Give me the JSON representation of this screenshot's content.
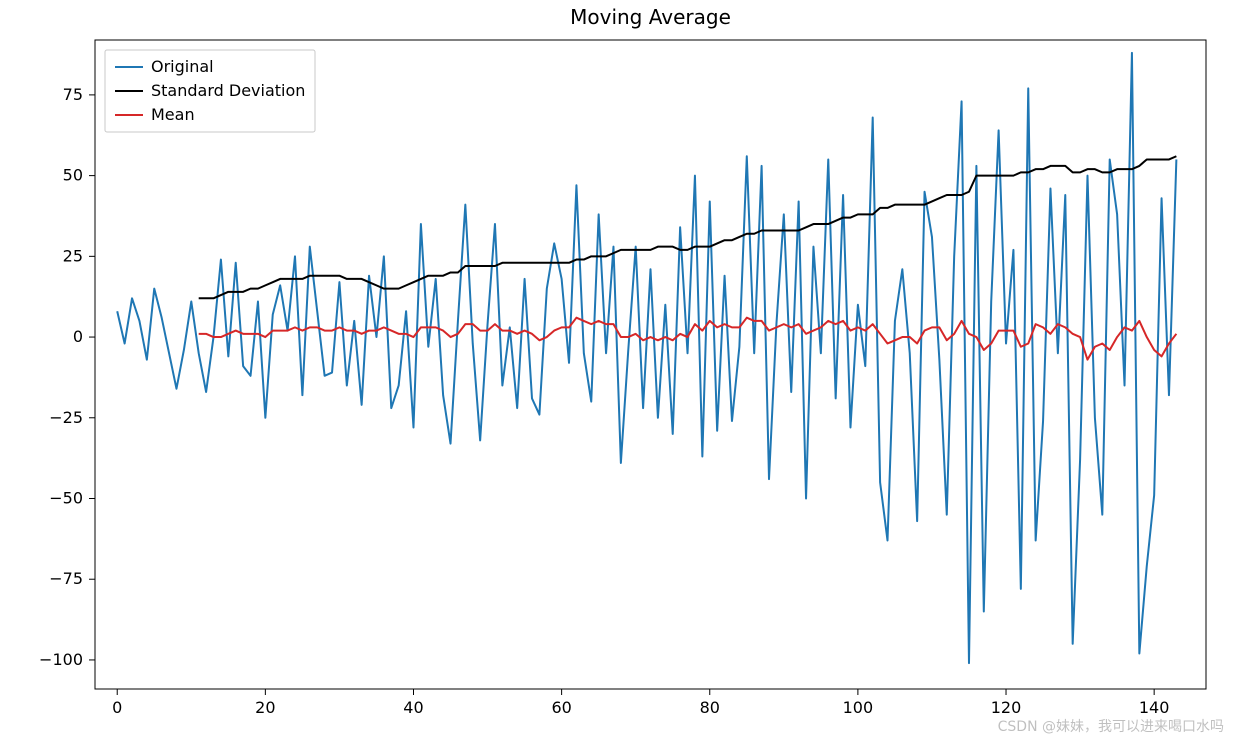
{
  "chart_data": {
    "type": "line",
    "title": "Moving Average",
    "xlabel": "",
    "ylabel": "",
    "xlim": [
      -3,
      147
    ],
    "ylim": [
      -109,
      92
    ],
    "xticks": [
      0,
      20,
      40,
      60,
      80,
      100,
      120,
      140
    ],
    "yticks": [
      -100,
      -75,
      -50,
      -25,
      0,
      25,
      50,
      75
    ],
    "series": [
      {
        "name": "Original",
        "color": "#1f77b4",
        "x": [
          0,
          1,
          2,
          3,
          4,
          5,
          6,
          7,
          8,
          9,
          10,
          11,
          12,
          13,
          14,
          15,
          16,
          17,
          18,
          19,
          20,
          21,
          22,
          23,
          24,
          25,
          26,
          27,
          28,
          29,
          30,
          31,
          32,
          33,
          34,
          35,
          36,
          37,
          38,
          39,
          40,
          41,
          42,
          43,
          44,
          45,
          46,
          47,
          48,
          49,
          50,
          51,
          52,
          53,
          54,
          55,
          56,
          57,
          58,
          59,
          60,
          61,
          62,
          63,
          64,
          65,
          66,
          67,
          68,
          69,
          70,
          71,
          72,
          73,
          74,
          75,
          76,
          77,
          78,
          79,
          80,
          81,
          82,
          83,
          84,
          85,
          86,
          87,
          88,
          89,
          90,
          91,
          92,
          93,
          94,
          95,
          96,
          97,
          98,
          99,
          100,
          101,
          102,
          103,
          104,
          105,
          106,
          107,
          108,
          109,
          110,
          111,
          112,
          113,
          114,
          115,
          116,
          117,
          118,
          119,
          120,
          121,
          122,
          123,
          124,
          125,
          126,
          127,
          128,
          129,
          130,
          131,
          132,
          133,
          134,
          135,
          136,
          137,
          138,
          139,
          140,
          141,
          142,
          143
        ],
        "values": [
          8,
          -2,
          12,
          5,
          -7,
          15,
          6,
          -5,
          -16,
          -4,
          11,
          -5,
          -17,
          0,
          24,
          -6,
          23,
          -9,
          -12,
          11,
          -25,
          7,
          16,
          2,
          25,
          -18,
          28,
          8,
          -12,
          -11,
          17,
          -15,
          5,
          -21,
          19,
          0,
          25,
          -22,
          -15,
          8,
          -28,
          35,
          -3,
          18,
          -18,
          -33,
          5,
          41,
          -2,
          -32,
          4,
          35,
          -15,
          3,
          -22,
          18,
          -19,
          -24,
          15,
          29,
          18,
          -8,
          47,
          -5,
          -20,
          38,
          -5,
          28,
          -39,
          -4,
          28,
          -22,
          21,
          -25,
          10,
          -30,
          34,
          -5,
          50,
          -37,
          42,
          -29,
          19,
          -26,
          -3,
          56,
          -5,
          53,
          -44,
          4,
          38,
          -17,
          42,
          -50,
          28,
          -5,
          55,
          -19,
          44,
          -28,
          10,
          -9,
          68,
          -45,
          -63,
          5,
          21,
          -5,
          -57,
          45,
          31,
          -7,
          -55,
          25,
          73,
          -101,
          53,
          -85,
          11,
          64,
          -2,
          27,
          -78,
          77,
          -63,
          -26,
          46,
          -5,
          44,
          -95,
          -38,
          50,
          -25,
          -55,
          55,
          38,
          -15,
          88,
          -98,
          -71,
          -49,
          43,
          -18,
          55
        ]
      },
      {
        "name": "Standard Deviation",
        "color": "#000000",
        "x": [
          11,
          12,
          13,
          14,
          15,
          16,
          17,
          18,
          19,
          20,
          21,
          22,
          23,
          24,
          25,
          26,
          27,
          28,
          29,
          30,
          31,
          32,
          33,
          34,
          35,
          36,
          37,
          38,
          39,
          40,
          41,
          42,
          43,
          44,
          45,
          46,
          47,
          48,
          49,
          50,
          51,
          52,
          53,
          54,
          55,
          56,
          57,
          58,
          59,
          60,
          61,
          62,
          63,
          64,
          65,
          66,
          67,
          68,
          69,
          70,
          71,
          72,
          73,
          74,
          75,
          76,
          77,
          78,
          79,
          80,
          81,
          82,
          83,
          84,
          85,
          86,
          87,
          88,
          89,
          90,
          91,
          92,
          93,
          94,
          95,
          96,
          97,
          98,
          99,
          100,
          101,
          102,
          103,
          104,
          105,
          106,
          107,
          108,
          109,
          110,
          111,
          112,
          113,
          114,
          115,
          116,
          117,
          118,
          119,
          120,
          121,
          122,
          123,
          124,
          125,
          126,
          127,
          128,
          129,
          130,
          131,
          132,
          133,
          134,
          135,
          136,
          137,
          138,
          139,
          140,
          141,
          142,
          143
        ],
        "values": [
          12,
          12,
          12,
          13,
          14,
          14,
          14,
          15,
          15,
          16,
          17,
          18,
          18,
          18,
          18,
          19,
          19,
          19,
          19,
          19,
          18,
          18,
          18,
          17,
          16,
          15,
          15,
          15,
          16,
          17,
          18,
          19,
          19,
          19,
          20,
          20,
          22,
          22,
          22,
          22,
          22,
          23,
          23,
          23,
          23,
          23,
          23,
          23,
          23,
          23,
          23,
          24,
          24,
          25,
          25,
          25,
          26,
          27,
          27,
          27,
          27,
          27,
          28,
          28,
          28,
          27,
          27,
          28,
          28,
          28,
          29,
          30,
          30,
          31,
          32,
          32,
          33,
          33,
          33,
          33,
          33,
          33,
          34,
          35,
          35,
          35,
          36,
          37,
          37,
          38,
          38,
          38,
          40,
          40,
          41,
          41,
          41,
          41,
          41,
          42,
          43,
          44,
          44,
          44,
          45,
          50,
          50,
          50,
          50,
          50,
          50,
          51,
          51,
          52,
          52,
          53,
          53,
          53,
          51,
          51,
          52,
          52,
          51,
          51,
          52,
          52,
          52,
          53,
          55,
          55,
          55,
          55,
          56
        ]
      },
      {
        "name": "Mean",
        "color": "#d62728",
        "x": [
          11,
          12,
          13,
          14,
          15,
          16,
          17,
          18,
          19,
          20,
          21,
          22,
          23,
          24,
          25,
          26,
          27,
          28,
          29,
          30,
          31,
          32,
          33,
          34,
          35,
          36,
          37,
          38,
          39,
          40,
          41,
          42,
          43,
          44,
          45,
          46,
          47,
          48,
          49,
          50,
          51,
          52,
          53,
          54,
          55,
          56,
          57,
          58,
          59,
          60,
          61,
          62,
          63,
          64,
          65,
          66,
          67,
          68,
          69,
          70,
          71,
          72,
          73,
          74,
          75,
          76,
          77,
          78,
          79,
          80,
          81,
          82,
          83,
          84,
          85,
          86,
          87,
          88,
          89,
          90,
          91,
          92,
          93,
          94,
          95,
          96,
          97,
          98,
          99,
          100,
          101,
          102,
          103,
          104,
          105,
          106,
          107,
          108,
          109,
          110,
          111,
          112,
          113,
          114,
          115,
          116,
          117,
          118,
          119,
          120,
          121,
          122,
          123,
          124,
          125,
          126,
          127,
          128,
          129,
          130,
          131,
          132,
          133,
          134,
          135,
          136,
          137,
          138,
          139,
          140,
          141,
          142,
          143
        ],
        "values": [
          1,
          1,
          0,
          0,
          1,
          2,
          1,
          1,
          1,
          0,
          2,
          2,
          2,
          3,
          2,
          3,
          3,
          2,
          2,
          3,
          2,
          2,
          1,
          2,
          2,
          3,
          2,
          1,
          1,
          0,
          3,
          3,
          3,
          2,
          0,
          1,
          4,
          4,
          2,
          2,
          4,
          2,
          2,
          1,
          2,
          1,
          -1,
          0,
          2,
          3,
          3,
          6,
          5,
          4,
          5,
          4,
          4,
          0,
          0,
          1,
          -1,
          0,
          -1,
          0,
          -1,
          1,
          0,
          4,
          2,
          5,
          3,
          4,
          3,
          3,
          6,
          5,
          5,
          2,
          3,
          4,
          3,
          4,
          1,
          2,
          3,
          5,
          4,
          5,
          2,
          3,
          2,
          4,
          1,
          -2,
          -1,
          0,
          0,
          -2,
          2,
          3,
          3,
          -1,
          1,
          5,
          1,
          0,
          -4,
          -2,
          2,
          2,
          2,
          -3,
          -2,
          4,
          3,
          1,
          4,
          3,
          1,
          0,
          -7,
          -3,
          -2,
          -4,
          0,
          3,
          2,
          5,
          0,
          -4,
          -6,
          -2,
          1
        ]
      }
    ],
    "legend": {
      "position": "upper-left",
      "entries": [
        "Original",
        "Standard Deviation",
        "Mean"
      ]
    }
  },
  "watermark": "CSDN @妹妹，我可以进来喝口水吗"
}
